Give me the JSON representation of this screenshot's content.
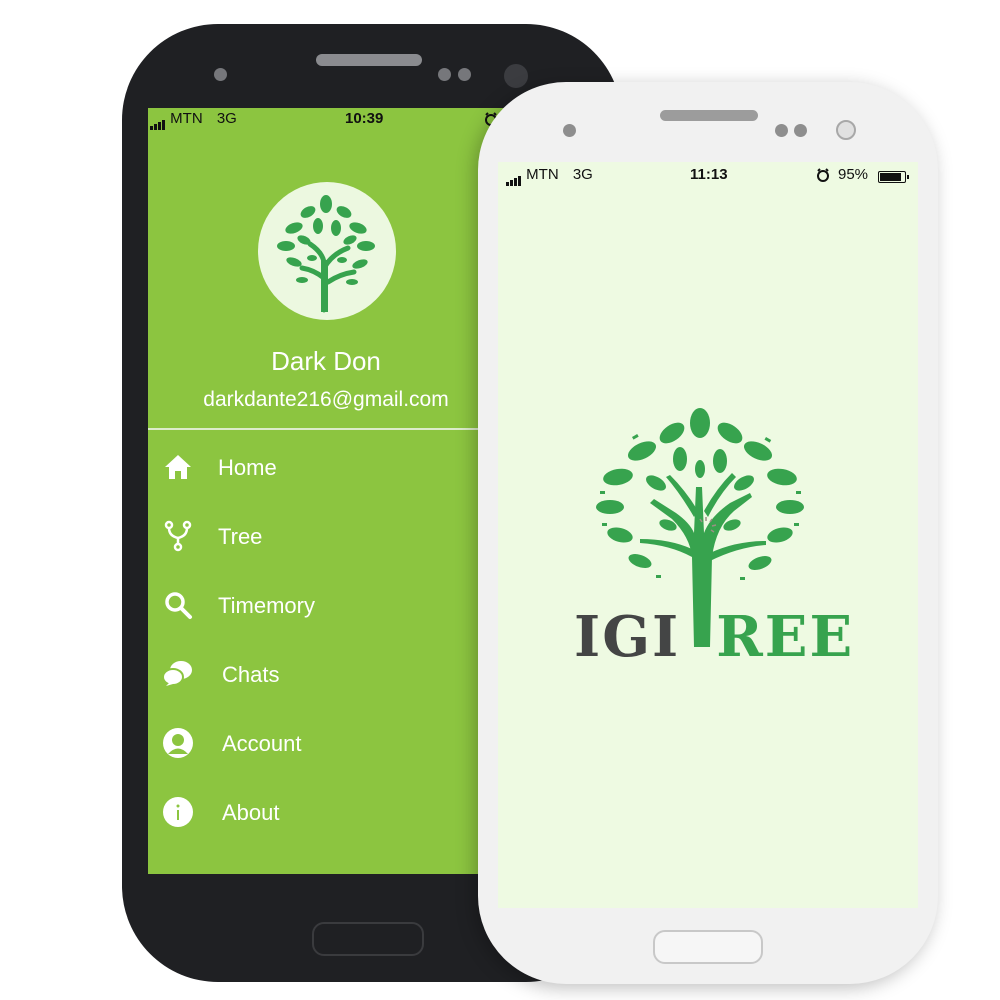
{
  "colors": {
    "drawer_green": "#8cc540",
    "splash_bg": "#eefae2",
    "tree_green": "#37a34e",
    "logo_dark": "#444545"
  },
  "left_phone": {
    "status_bar": {
      "carrier": "MTN",
      "network": "3G",
      "time": "10:39",
      "icons": [
        "signal-icon",
        "alarm-icon"
      ]
    },
    "profile": {
      "name": "Dark Don",
      "email": "darkdante216@gmail.com",
      "avatar": "tree-logo-icon"
    },
    "menu": [
      {
        "label": "Home",
        "icon": "home-icon"
      },
      {
        "label": "Tree",
        "icon": "branch-icon"
      },
      {
        "label": "Timemory",
        "icon": "search-icon"
      },
      {
        "label": "Chats",
        "icon": "chat-bubbles-icon"
      },
      {
        "label": "Account",
        "icon": "account-icon"
      },
      {
        "label": "About",
        "icon": "info-icon"
      }
    ]
  },
  "right_phone": {
    "status_bar": {
      "carrier": "MTN",
      "network": "3G",
      "time": "11:13",
      "battery": "95%",
      "icons": [
        "signal-icon",
        "alarm-icon",
        "battery-icon"
      ]
    },
    "splash": {
      "logo_left": "IGI",
      "logo_right": "REE",
      "logo_icon": "tree-logo-icon",
      "loading": "spinner-icon"
    }
  }
}
